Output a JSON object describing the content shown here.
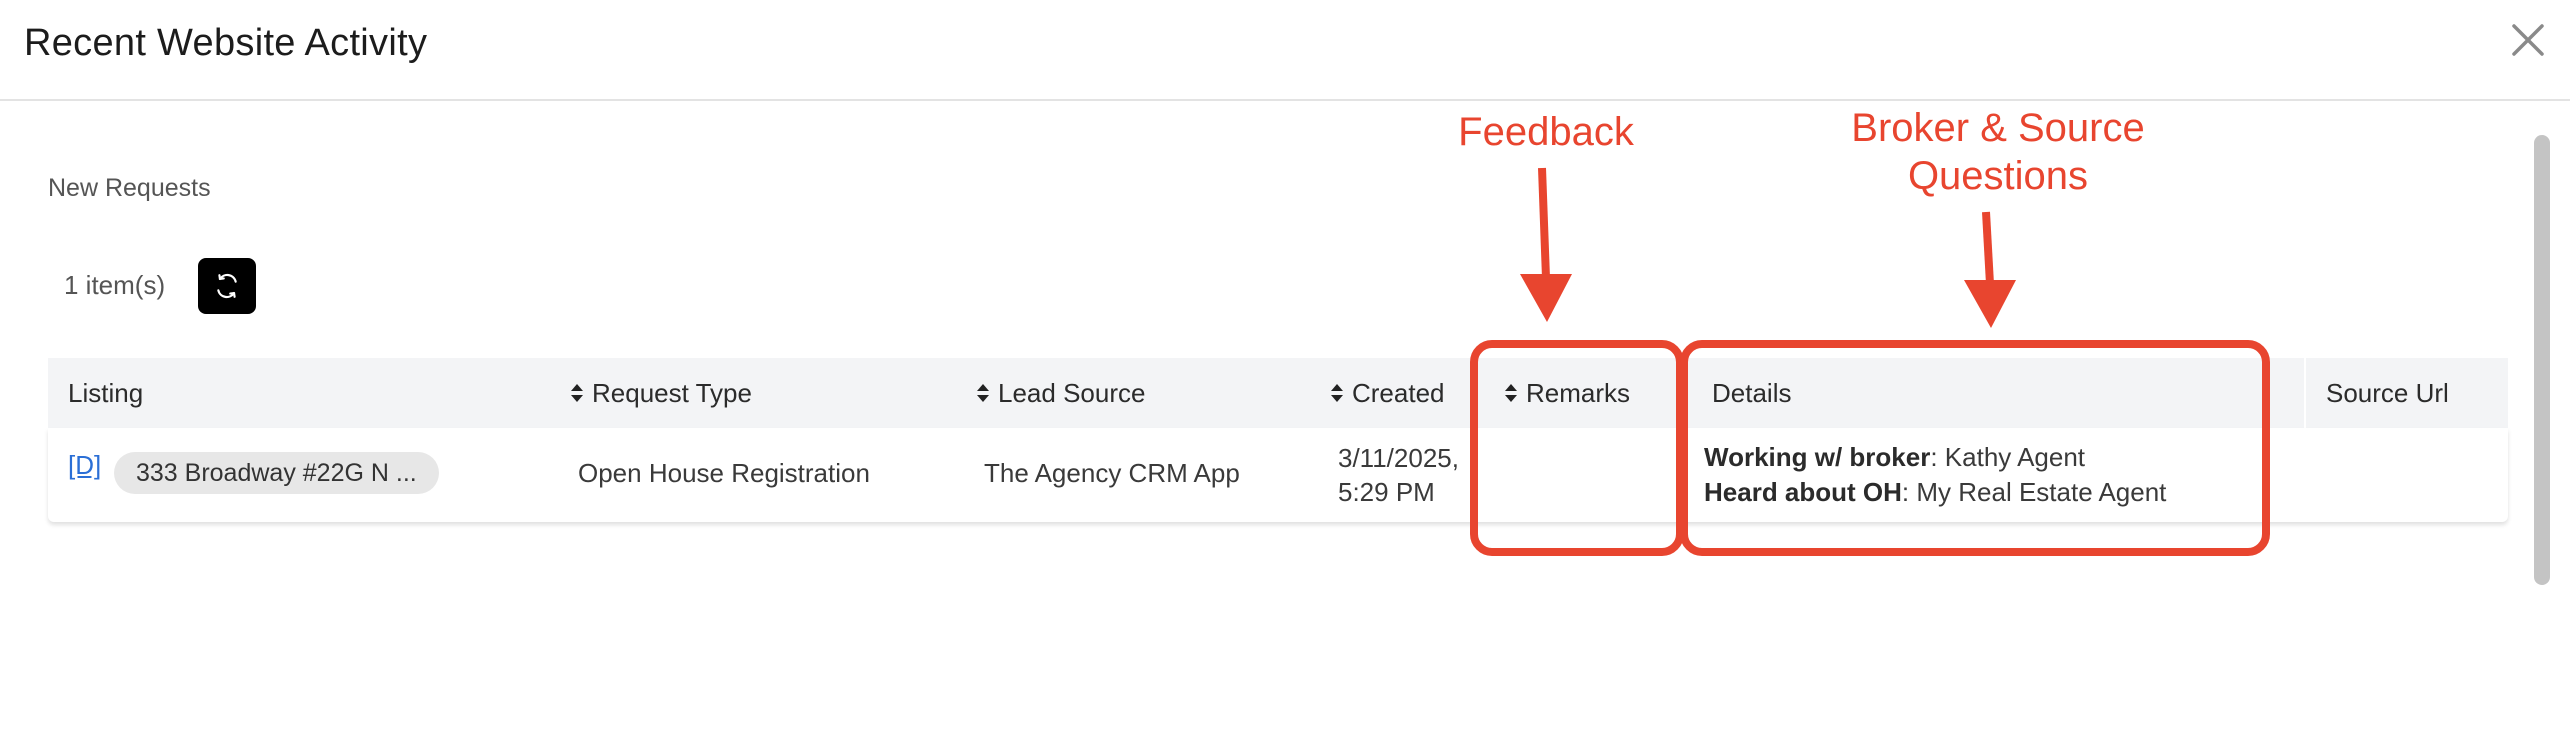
{
  "modal": {
    "title": "Recent Website Activity",
    "close_icon": "close-icon"
  },
  "section": {
    "label": "New Requests",
    "count": "1 item(s)",
    "refresh_icon": "refresh-icon"
  },
  "table": {
    "columns": [
      {
        "label": "Listing",
        "sortable": false
      },
      {
        "label": "Request Type",
        "sortable": true
      },
      {
        "label": "Lead Source",
        "sortable": true
      },
      {
        "label": "Created",
        "sortable": true
      },
      {
        "label": "Remarks",
        "sortable": true
      },
      {
        "label": "Details",
        "sortable": false
      },
      {
        "label": "Source Url",
        "sortable": false
      }
    ],
    "rows": [
      {
        "listing_link": "[D]",
        "listing_address": "333 Broadway #22G N ...",
        "request_type": "Open House Registration",
        "lead_source": "The Agency CRM App",
        "created_date": "3/11/2025,",
        "created_time": "5:29 PM",
        "remarks": "",
        "details": [
          {
            "label": "Working w/ broker",
            "value": ": Kathy Agent"
          },
          {
            "label": "Heard about OH",
            "value": ": My Real Estate Agent"
          }
        ],
        "source_url": ""
      }
    ]
  },
  "annotations": {
    "feedback": "Feedback",
    "broker_line1": "Broker & Source",
    "broker_line2": "Questions",
    "color": "#e8452f"
  },
  "colors": {
    "header_bg": "#f3f4f6",
    "link": "#2b6fd6",
    "refresh_bg": "#000000"
  }
}
